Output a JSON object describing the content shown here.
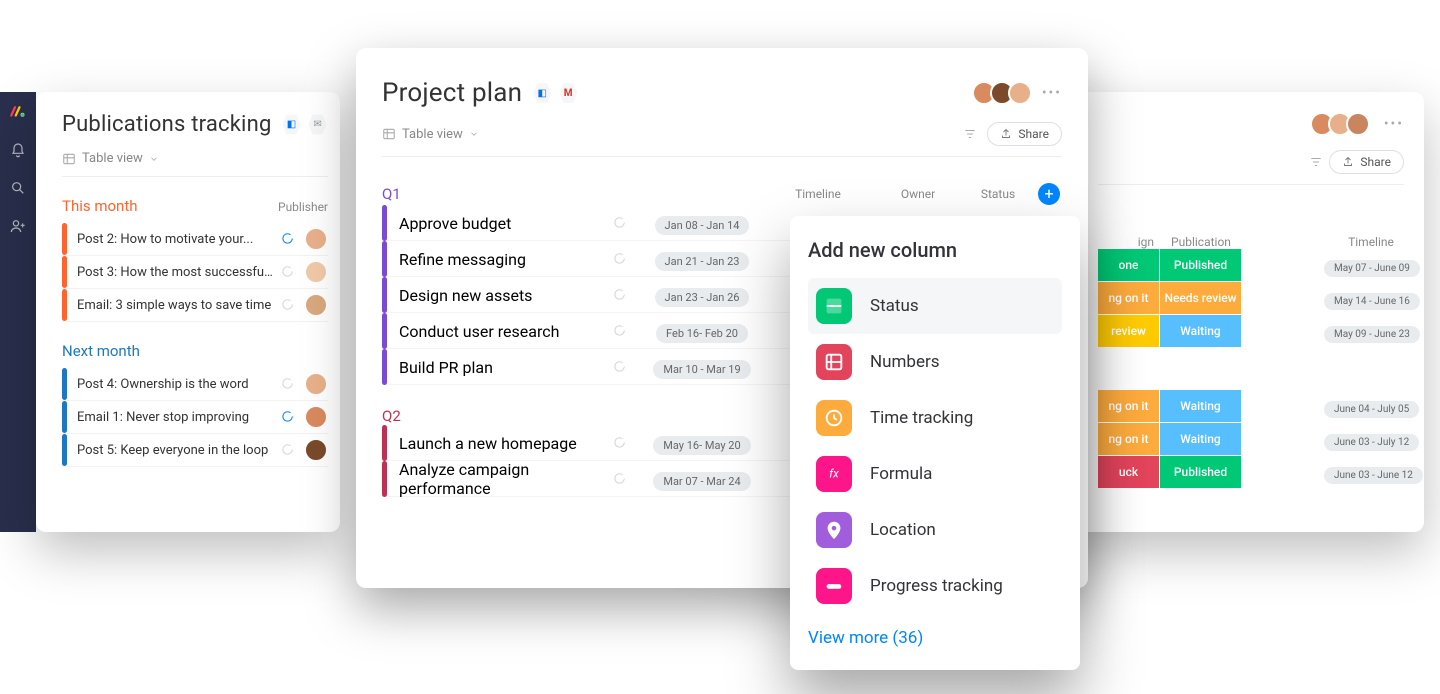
{
  "rail": {
    "icons": [
      "logo",
      "bell",
      "search",
      "user-add"
    ]
  },
  "leftBoard": {
    "title": "Publications tracking",
    "tableView": "Table view",
    "publisherColHead": "Publisher",
    "groups": [
      {
        "title": "This month",
        "color": "#ff642e",
        "rows": [
          {
            "name": "Post 2: How to motivate your...",
            "chatActive": true,
            "avatar": "#e8b08a"
          },
          {
            "name": "Post 3: How the most successful...",
            "chatActive": false,
            "avatar": "#f0c9a8"
          },
          {
            "name": "Email: 3 simple ways to save time",
            "chatActive": false,
            "avatar": "#d9a87e"
          }
        ]
      },
      {
        "title": "Next month",
        "color": "#1f76c2",
        "rows": [
          {
            "name": "Post 4: Ownership is the word",
            "chatActive": false,
            "avatar": "#e8b08a"
          },
          {
            "name": "Email 1: Never stop improving",
            "chatActive": true,
            "avatar": "#d98a5e"
          },
          {
            "name": "Post 5: Keep everyone in the loop",
            "chatActive": false,
            "avatar": "#7a4a2a"
          }
        ]
      }
    ]
  },
  "centerBoard": {
    "title": "Project plan",
    "tableView": "Table view",
    "share": "Share",
    "avatars": [
      "#d98a5e",
      "#7a4a2a",
      "#e8b08a"
    ],
    "cols": [
      "Timeline",
      "Owner",
      "Status"
    ],
    "groups": [
      {
        "title": "Q1",
        "color": "#784bd1",
        "rows": [
          {
            "name": "Approve budget",
            "timeline": "Jan 08 - Jan 14"
          },
          {
            "name": "Refine messaging",
            "timeline": "Jan 21 - Jan 23"
          },
          {
            "name": "Design new assets",
            "timeline": "Jan 23 - Jan 26"
          },
          {
            "name": "Conduct user research",
            "timeline": "Feb 16- Feb 20"
          },
          {
            "name": "Build PR plan",
            "timeline": "Mar 10 - Mar 19"
          }
        ]
      },
      {
        "title": "Q2",
        "color": "#bb3354",
        "rows": [
          {
            "name": "Launch a new homepage",
            "timeline": "May 16- May 20"
          },
          {
            "name": "Analyze campaign performance",
            "timeline": "Mar 07 - Mar 24"
          }
        ]
      }
    ]
  },
  "popup": {
    "title": "Add new column",
    "options": [
      {
        "label": "Status",
        "color": "#00c875",
        "icon": "status"
      },
      {
        "label": "Numbers",
        "color": "#e2445c",
        "icon": "numbers"
      },
      {
        "label": "Time tracking",
        "color": "#fdab3d",
        "icon": "clock"
      },
      {
        "label": "Formula",
        "color": "#ff158a",
        "icon": "fx"
      },
      {
        "label": "Location",
        "color": "#a25ddc",
        "icon": "pin"
      },
      {
        "label": "Progress tracking",
        "color": "#ff158a",
        "icon": "progress"
      }
    ],
    "viewMore": "View more (36)"
  },
  "rightBoard": {
    "share": "Share",
    "avatars": [
      "#d98a5e",
      "#e8b08a",
      "#c9855e"
    ],
    "cols": [
      "ign",
      "Publication",
      "Timeline"
    ],
    "segments": [
      [
        {
          "c1": {
            "t": "one",
            "bg": "#00c875"
          },
          "c2": {
            "t": "Published",
            "bg": "#00c875"
          },
          "c3": "May 07 - June 09"
        },
        {
          "c1": {
            "t": "ng on it",
            "bg": "#fdab3d"
          },
          "c2": {
            "t": "Needs review",
            "bg": "#fdab3d"
          },
          "c3": "May 14 - June 16"
        },
        {
          "c1": {
            "t": "review",
            "bg": "#ffcb00"
          },
          "c2": {
            "t": "Waiting",
            "bg": "#57bffd"
          },
          "c3": "May 09 - June 23"
        }
      ],
      [
        {
          "c1": {
            "t": "ng on it",
            "bg": "#fdab3d"
          },
          "c2": {
            "t": "Waiting",
            "bg": "#57bffd"
          },
          "c3": "June 04 - July 05"
        },
        {
          "c1": {
            "t": "ng on it",
            "bg": "#fdab3d"
          },
          "c2": {
            "t": "Waiting",
            "bg": "#57bffd"
          },
          "c3": "June 03 - July 12"
        },
        {
          "c1": {
            "t": "uck",
            "bg": "#e2445c"
          },
          "c2": {
            "t": "Published",
            "bg": "#00c875"
          },
          "c3": "June 03 - June 12"
        }
      ]
    ]
  },
  "colors": {
    "blue": "#0086ff"
  }
}
